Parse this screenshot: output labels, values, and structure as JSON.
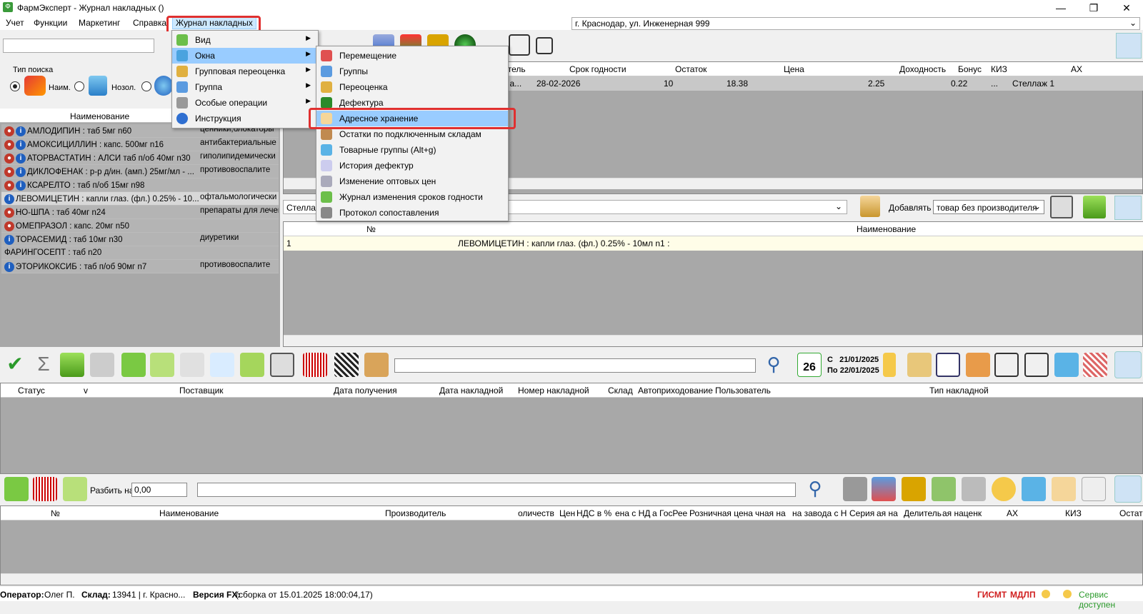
{
  "window": {
    "title": "ФармЭксперт - Журнал накладных ()",
    "app_icon": "pharm-app-icon"
  },
  "menubar": {
    "items": [
      "Учет",
      "Функции",
      "Маркетинг",
      "Справка",
      "Журнал накладных"
    ]
  },
  "address": "г. Краснодар, ул. Инженерная 999",
  "search_type": {
    "label": "Тип поиска",
    "opt1": "Наим.",
    "opt2": "Нозол."
  },
  "left_list": {
    "header": "Наименование",
    "rows": [
      {
        "name": "АМЛОДИПИН : таб 5мг n60",
        "desc": "ценники,блокаторы"
      },
      {
        "name": "АМОКСИЦИЛЛИН : капс. 500мг n16",
        "desc": "антибактериальные"
      },
      {
        "name": "АТОРВАСТАТИН : АЛСИ таб п/об 40мг n30",
        "desc": "гиполипидемически"
      },
      {
        "name": "ДИКЛОФЕНАК : р-р д/ин. (амп.) 25мг/мл - ...",
        "desc": "противовоспалите"
      },
      {
        "name": "КСАРЕЛТО : таб п/об 15мг n98",
        "desc": ""
      },
      {
        "name": "ЛЕВОМИЦЕТИН : капли глаз. (фл.) 0.25% - 10...",
        "desc": "офтальмологически"
      },
      {
        "name": "НО-ШПА : таб 40мг n24",
        "desc": "препараты для лечен"
      },
      {
        "name": "ОМЕПРАЗОЛ : капс. 20мг n50",
        "desc": ""
      },
      {
        "name": "ТОРАСЕМИД : таб 10мг n30",
        "desc": "диуретики"
      },
      {
        "name": "ФАРИНГОСЕПТ : таб n20",
        "desc": ""
      },
      {
        "name": "ЭТОРИКОКСИБ : таб п/об 90мг n7",
        "desc": "противовоспалите"
      }
    ]
  },
  "top_grid": {
    "headers": [
      "дитель",
      "Срок годности",
      "Остаток",
      "Цена",
      "Доходность",
      "Бонус",
      "КИЗ",
      "АХ"
    ],
    "row": {
      "maker": "ая а...",
      "expiry": "28-02-2026",
      "stock": "10",
      "price": "18.38",
      "profit": "2.25",
      "bonus": "0.22",
      "kiz": "...",
      "ah": "Стеллаж 1"
    }
  },
  "middle": {
    "shelf_label": "Стеллаж",
    "add_label": "Добавлять",
    "add_value": "товар без производителя",
    "headers": [
      "№",
      "Наименование"
    ],
    "row": {
      "num": "1",
      "name": "ЛЕВОМИЦЕТИН : капли глаз. (фл.) 0.25% - 10мл n1 :"
    }
  },
  "dates": {
    "from_label": "С",
    "from": "21/01/2025",
    "to_label": "По",
    "to": "22/01/2025",
    "calendar_day": "26"
  },
  "invoice_grid": {
    "headers": [
      "Статус",
      "v",
      "Поставщик",
      "Дата получения",
      "Дата накладной",
      "Номер накладной",
      "Склад",
      "Автоприходование",
      "Пользователь",
      "Тип накладной"
    ]
  },
  "bottom_toolbar": {
    "split_label": "Разбить на",
    "split_value": "0,00"
  },
  "bottom_grid": {
    "headers": [
      "№",
      "Наименование",
      "Производитель",
      "оличеств",
      "Цен",
      "НДС в %",
      "ена с НД",
      "а ГосРее",
      "Розничная цена",
      "чная на",
      "на завода с Н",
      "Серия",
      "ая на",
      "Делитель",
      "ая наценк",
      "АХ",
      "КИЗ",
      "Остат"
    ]
  },
  "menu_journal": {
    "items": [
      {
        "label": "Вид",
        "icon": "view-icon"
      },
      {
        "label": "Окна",
        "icon": "windows-icon"
      },
      {
        "label": "Групповая переоценка",
        "icon": "group-reprice-icon"
      },
      {
        "label": "Группа",
        "icon": "group-icon"
      },
      {
        "label": "Особые операции",
        "icon": "special-ops-icon"
      },
      {
        "label": "Инструкция",
        "icon": "help-icon"
      }
    ]
  },
  "menu_windows": {
    "items": [
      {
        "label": "Перемещение",
        "icon": "transfer-icon"
      },
      {
        "label": "Группы",
        "icon": "groups-icon"
      },
      {
        "label": "Переоценка",
        "icon": "reprice-icon"
      },
      {
        "label": "Дефектура",
        "icon": "defect-icon"
      },
      {
        "label": "Адресное хранение",
        "icon": "address-storage-icon"
      },
      {
        "label": "Остатки по подключенным складам",
        "icon": "stock-warehouses-icon"
      },
      {
        "label": "Товарные группы (Alt+g)",
        "icon": "product-groups-icon"
      },
      {
        "label": "История дефектур",
        "icon": "defect-history-icon"
      },
      {
        "label": "Изменение оптовых цен",
        "icon": "wholesale-price-icon"
      },
      {
        "label": "Журнал изменения сроков годности",
        "icon": "expiry-journal-icon"
      },
      {
        "label": "Протокол сопоставления",
        "icon": "match-protocol-icon"
      }
    ]
  },
  "statusbar": {
    "operator_label": "Оператор:",
    "operator": "Олег П.",
    "store_label": "Склад:",
    "store": "13941 | г. Красно...",
    "version_label": "Версия FX:",
    "version": "(сборка от 15.01.2025 18:00:04,17)",
    "gismt": "ГИСМТ",
    "mdlp": "МДЛП",
    "service": "Сервис доступен"
  },
  "colors": {
    "highlight": "#99ccff",
    "red": "#e03030",
    "panel_gray": "#a8a8a8",
    "selected_row": "#fffde8"
  }
}
